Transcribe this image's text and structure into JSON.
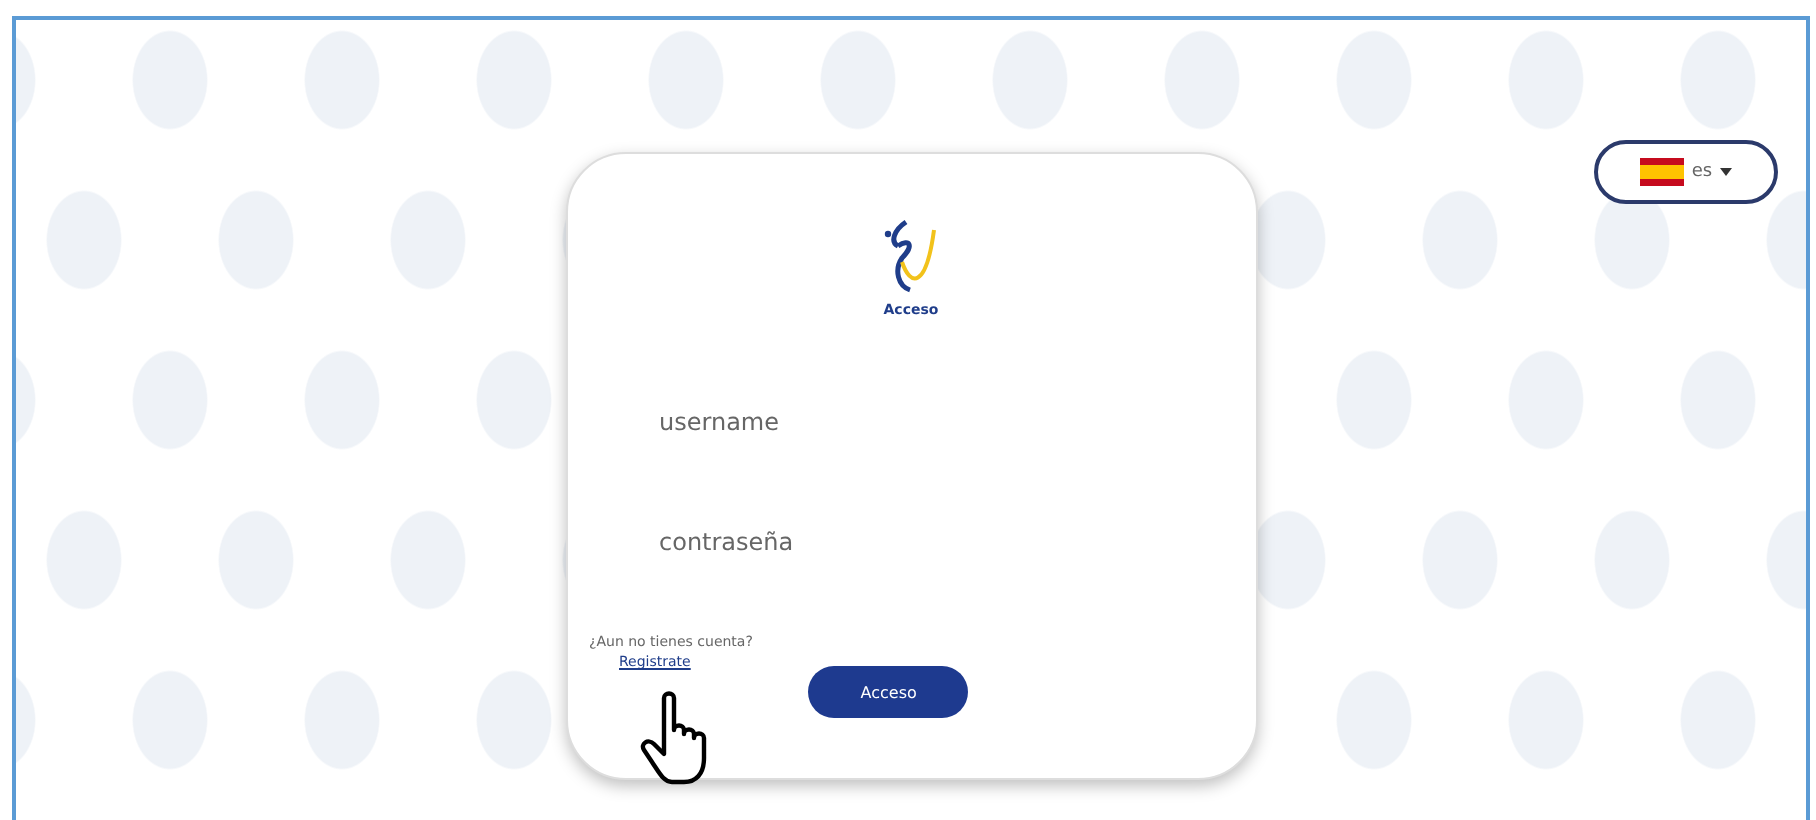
{
  "language_selector": {
    "code": "es"
  },
  "login_card": {
    "logo_caption": "Acceso",
    "fields": [
      {
        "placeholder": "username"
      },
      {
        "placeholder": "contraseña"
      }
    ],
    "signup_prompt": "¿Aun no tienes cuenta?",
    "signup_link": "Registrate",
    "submit_button": "Acceso"
  }
}
